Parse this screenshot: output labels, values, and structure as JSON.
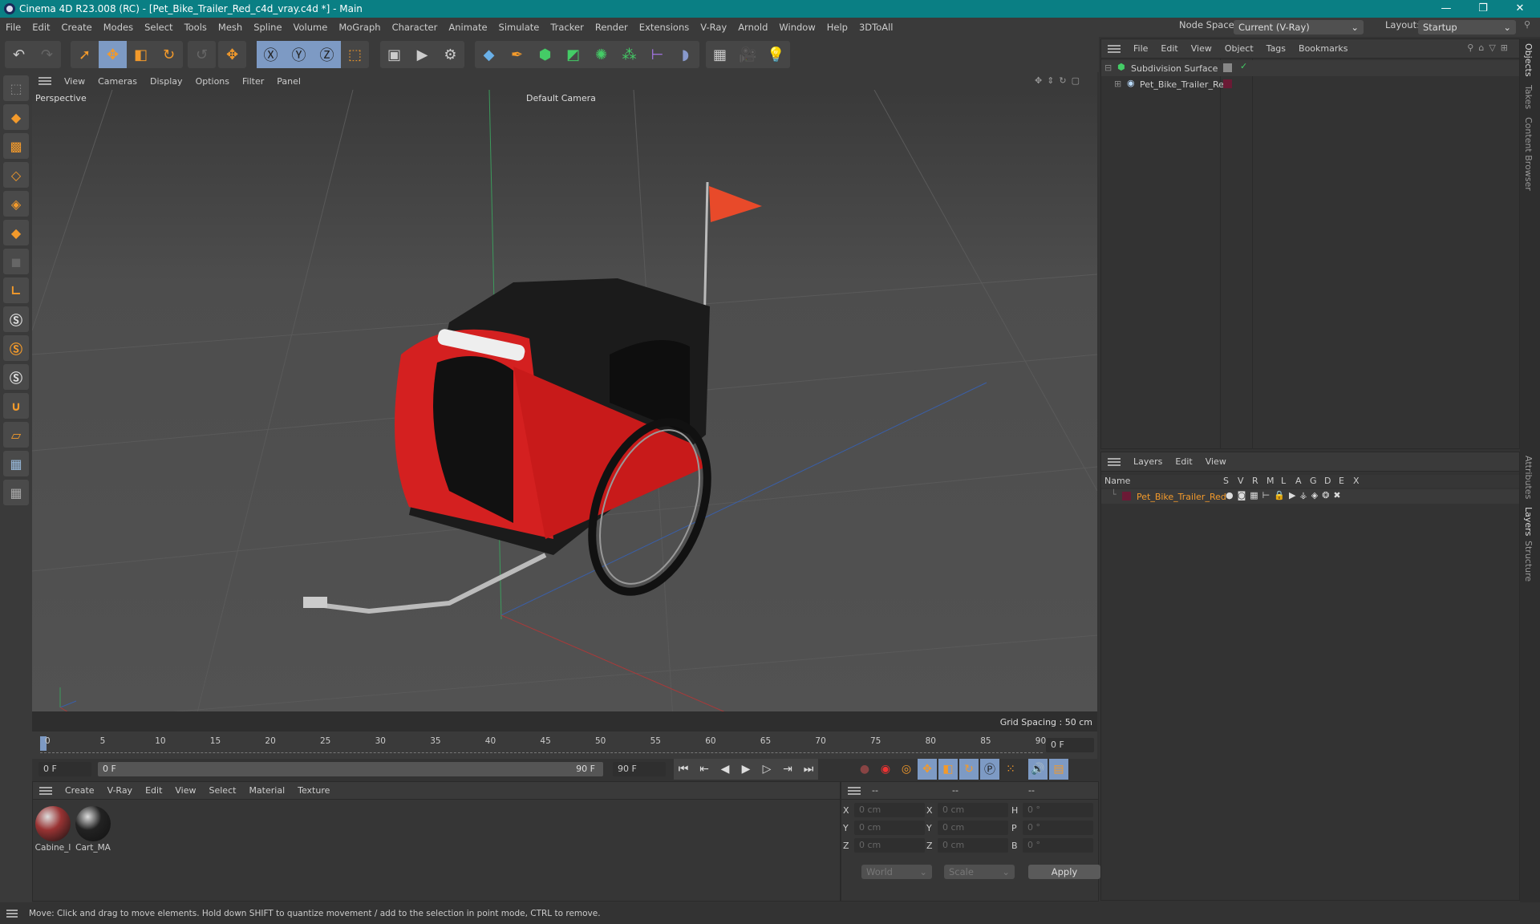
{
  "title": "Cinema 4D R23.008 (RC) - [Pet_Bike_Trailer_Red_c4d_vray.c4d *] - Main",
  "menu": [
    "File",
    "Edit",
    "Create",
    "Modes",
    "Select",
    "Tools",
    "Mesh",
    "Spline",
    "Volume",
    "MoGraph",
    "Character",
    "Animate",
    "Simulate",
    "Tracker",
    "Render",
    "Extensions",
    "V-Ray",
    "Arnold",
    "Window",
    "Help",
    "3DToAll"
  ],
  "node_space": {
    "label": "Node Space:",
    "value": "Current (V-Ray)"
  },
  "layout": {
    "label": "Layout:",
    "value": "Startup"
  },
  "viewport": {
    "menu": [
      "View",
      "Cameras",
      "Display",
      "Options",
      "Filter",
      "Panel"
    ],
    "label": "Perspective",
    "camera": "Default Camera",
    "grid_spacing": "Grid Spacing : 50 cm"
  },
  "timeline": {
    "ticks": [
      "0",
      "5",
      "10",
      "15",
      "20",
      "25",
      "30",
      "35",
      "40",
      "45",
      "50",
      "55",
      "60",
      "65",
      "70",
      "75",
      "80",
      "85",
      "90"
    ],
    "current": "0 F",
    "start": "0 F",
    "range_start": "0 F",
    "range_end": "90 F",
    "end": "90 F"
  },
  "materials": {
    "menu": [
      "Create",
      "V-Ray",
      "Edit",
      "View",
      "Select",
      "Material",
      "Texture"
    ],
    "items": [
      {
        "name": "Cabine_l"
      },
      {
        "name": "Cart_MA"
      }
    ]
  },
  "coords": {
    "headers": [
      "--",
      "--",
      "--"
    ],
    "rows": [
      {
        "a": "X",
        "av": "0 cm",
        "b": "X",
        "bv": "0 cm",
        "c": "H",
        "cv": "0 °"
      },
      {
        "a": "Y",
        "av": "0 cm",
        "b": "Y",
        "bv": "0 cm",
        "c": "P",
        "cv": "0 °"
      },
      {
        "a": "Z",
        "av": "0 cm",
        "b": "Z",
        "bv": "0 cm",
        "c": "B",
        "cv": "0 °"
      }
    ],
    "world": "World",
    "scale": "Scale",
    "apply": "Apply"
  },
  "objects": {
    "menu": [
      "File",
      "Edit",
      "View",
      "Object",
      "Tags",
      "Bookmarks"
    ],
    "items": [
      {
        "name": "Subdivision Surface"
      },
      {
        "name": "Pet_Bike_Trailer_Red"
      }
    ]
  },
  "layers": {
    "menu": [
      "Layers",
      "Edit",
      "View"
    ],
    "columns": [
      "Name",
      "S",
      "V",
      "R",
      "M",
      "L",
      "A",
      "G",
      "D",
      "E",
      "X"
    ],
    "items": [
      {
        "name": "Pet_Bike_Trailer_Red",
        "color": "#6b1a35"
      }
    ]
  },
  "side_tabs": [
    "Objects",
    "Takes",
    "Content Browser",
    "Attributes",
    "Layers",
    "Structure"
  ],
  "status": "Move: Click and drag to move elements. Hold down SHIFT to quantize movement / add to the selection in point mode, CTRL to remove.",
  "colors": {
    "titlebar": "#0a7f84",
    "accent": "#f39a2b",
    "layer_text": "#f39a2b"
  }
}
